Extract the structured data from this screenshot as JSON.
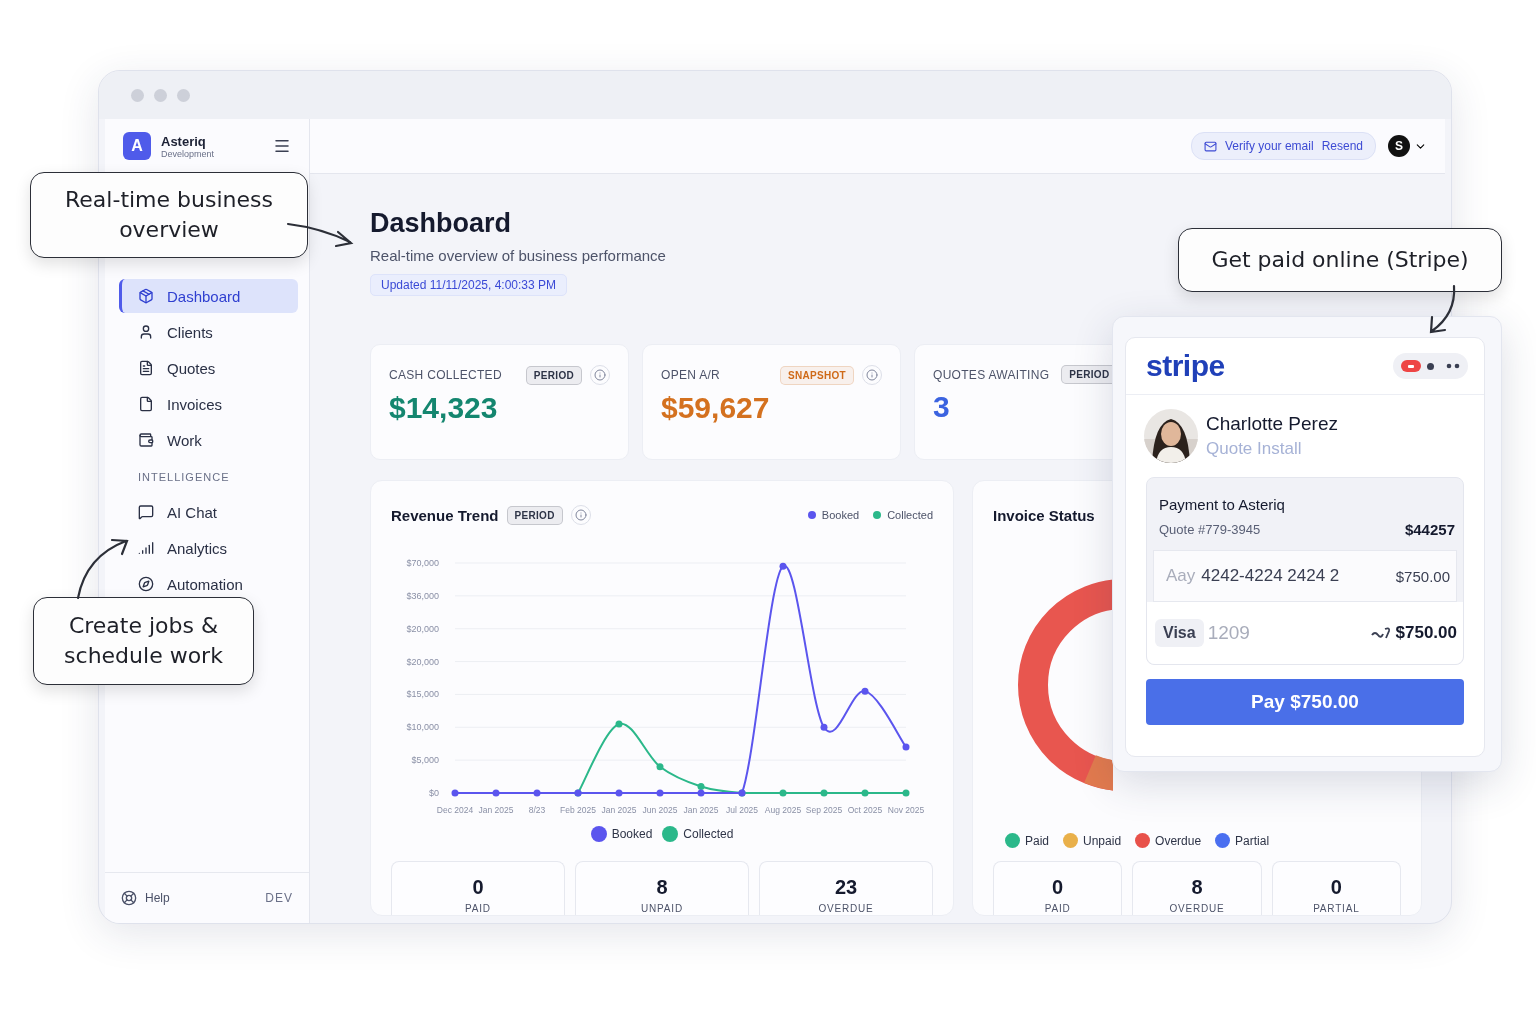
{
  "sidebar": {
    "brand": {
      "initial": "A",
      "name": "Asteriq",
      "env": "Development"
    },
    "items": [
      {
        "label": "Dashboard",
        "selected": true
      },
      {
        "label": "Clients",
        "selected": false
      },
      {
        "label": "Quotes",
        "selected": false
      },
      {
        "label": "Invoices",
        "selected": false
      },
      {
        "label": "Work",
        "selected": false
      }
    ],
    "section": "INTELLIGENCE",
    "intelligence_items": [
      {
        "label": "AI Chat",
        "selected": false
      },
      {
        "label": "Analytics",
        "selected": false
      },
      {
        "label": "Automation",
        "selected": false
      }
    ],
    "footer": {
      "help": "Help",
      "env": "DEV"
    }
  },
  "topbar": {
    "verify": "Verify your email",
    "resend": "Resend",
    "avatar": "S"
  },
  "header": {
    "title": "Dashboard",
    "subtitle": "Real-time overview of business performance",
    "updated": "Updated 11/11/2025, 4:00:33 PM"
  },
  "kpis": [
    {
      "label": "CASH COLLECTED",
      "badge": {
        "text": "PERIOD",
        "color": "#2e3447"
      },
      "info": true,
      "value": "$14,323",
      "color": "#14866f"
    },
    {
      "label": "OPEN A/R",
      "badge": {
        "text": "SNAPSHOT",
        "color": "#cf6a18"
      },
      "info": true,
      "value": "$59,627",
      "color": "#d4711f"
    },
    {
      "label": "QUOTES AWAITING",
      "badge": {
        "text": "PERIOD",
        "color": "#2e3447"
      },
      "info": false,
      "value": "3",
      "color": "#3b63e0"
    }
  ],
  "revenue": {
    "title": "Revenue Trend",
    "badge": "PERIOD",
    "legend": [
      {
        "name": "Booked",
        "color": "#5b55ee"
      },
      {
        "name": "Collected",
        "color": "#2bb88a"
      }
    ],
    "upper_axis_labels": [
      "$70,000",
      "$36,000",
      "$20,000"
    ],
    "chart_data": {
      "type": "line",
      "grid": true,
      "categories": [
        "Dec 2024",
        "Jan 2025",
        "8/23",
        "Feb 2025",
        "Jan 2025",
        "Jun 2025",
        "Jan 2025",
        "Jul 2025",
        "Aug 2025",
        "Sep 2025",
        "Oct 2025",
        "Nov 2025"
      ],
      "ylim": [
        0,
        35000
      ],
      "yticks": [
        {
          "value": 0,
          "label": "$0"
        },
        {
          "value": 5000,
          "label": "$5,000"
        },
        {
          "value": 10000,
          "label": "$10,000"
        },
        {
          "value": 15000,
          "label": "$15,000"
        },
        {
          "value": 20000,
          "label": "$20,000"
        }
      ],
      "series": [
        {
          "name": "Booked",
          "color": "#5b55ee",
          "marker": "circle",
          "values": [
            0,
            0,
            0,
            0,
            0,
            0,
            0,
            0,
            34500,
            10000,
            15500,
            7000
          ]
        },
        {
          "name": "Collected",
          "color": "#2bb88a",
          "marker": "circle",
          "values": [
            null,
            null,
            null,
            0,
            10500,
            4000,
            1000,
            0,
            0,
            0,
            0,
            0
          ]
        }
      ]
    },
    "stats": [
      {
        "value": "0",
        "label": "PAID"
      },
      {
        "value": "8",
        "label": "UNPAID"
      },
      {
        "value": "23",
        "label": "OVERDUE"
      }
    ]
  },
  "invoice_status": {
    "title": "Invoice Status",
    "legend": [
      {
        "name": "Paid",
        "color": "#2bb88a"
      },
      {
        "name": "Unpaid",
        "color": "#e9b04a"
      },
      {
        "name": "Overdue",
        "color": "#e8514a"
      },
      {
        "name": "Partial",
        "color": "#4a6ff0"
      }
    ],
    "stats": [
      {
        "value": "0",
        "label": "PAID"
      },
      {
        "value": "8",
        "label": "OVERDUE"
      },
      {
        "value": "0",
        "label": "PARTIAL"
      }
    ]
  },
  "stripe": {
    "logo": "stripe",
    "customer": {
      "name": "Charlotte Perez",
      "subtitle": "Quote Install"
    },
    "payment": {
      "title": "Payment to Asteriq",
      "quote": "Quote #779-3945",
      "amount": "$44257"
    },
    "card_row": {
      "placeholder": "Aay",
      "number": "4242-4224 2424 2",
      "amount": "$750.00"
    },
    "saved_card": {
      "brand": "Visa",
      "last4": "1209",
      "amount": "$750.00"
    },
    "button": "Pay $750.00"
  },
  "callouts": [
    {
      "text": "Real-time business overview"
    },
    {
      "text": "Get paid online (Stripe)"
    },
    {
      "text": "Create jobs & schedule work"
    }
  ]
}
